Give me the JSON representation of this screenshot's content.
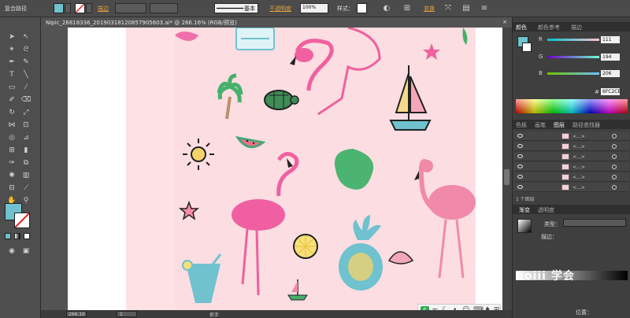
{
  "control_bar": {
    "object_type": "复合路径",
    "stroke_link": "描边",
    "stroke_profile": "基本",
    "opacity_link": "不透明度",
    "opacity_value": "100%",
    "style_label": "样式：",
    "transform_link": "变换"
  },
  "document_tab": {
    "title": "Nipic_26818336_20190318120857905603.ai* @ 266.16% (RGB/预览)",
    "close": "×"
  },
  "color_panel": {
    "tabs": [
      "颜色",
      "颜色参考",
      "描边"
    ],
    "channels": [
      {
        "label": "R",
        "value": "111"
      },
      {
        "label": "G",
        "value": "194"
      },
      {
        "label": "B",
        "value": "206"
      }
    ],
    "hex_prefix": "#",
    "hex": "6FC2CE",
    "fill_color": "#6fc2ce"
  },
  "layers_panel": {
    "tabs": [
      "色板",
      "画笔",
      "图层",
      "路径查找器"
    ],
    "layers": [
      {
        "name": "<...>"
      },
      {
        "name": "<...>"
      },
      {
        "name": "<...>"
      },
      {
        "name": "<...>"
      },
      {
        "name": "<...>"
      },
      {
        "name": "<...>"
      }
    ],
    "footer": "1 个图层"
  },
  "gradient_panel": {
    "tabs": [
      "渐变",
      "透明度"
    ],
    "type_label": "类型：",
    "stroke_label": "描边：",
    "position_label": "位置："
  },
  "status_bar": {
    "zoom": "266.16",
    "page": "1",
    "tool": "抓手"
  },
  "ime": {
    "logo": "S",
    "label": "五"
  },
  "watermark": "hoiii 学会"
}
